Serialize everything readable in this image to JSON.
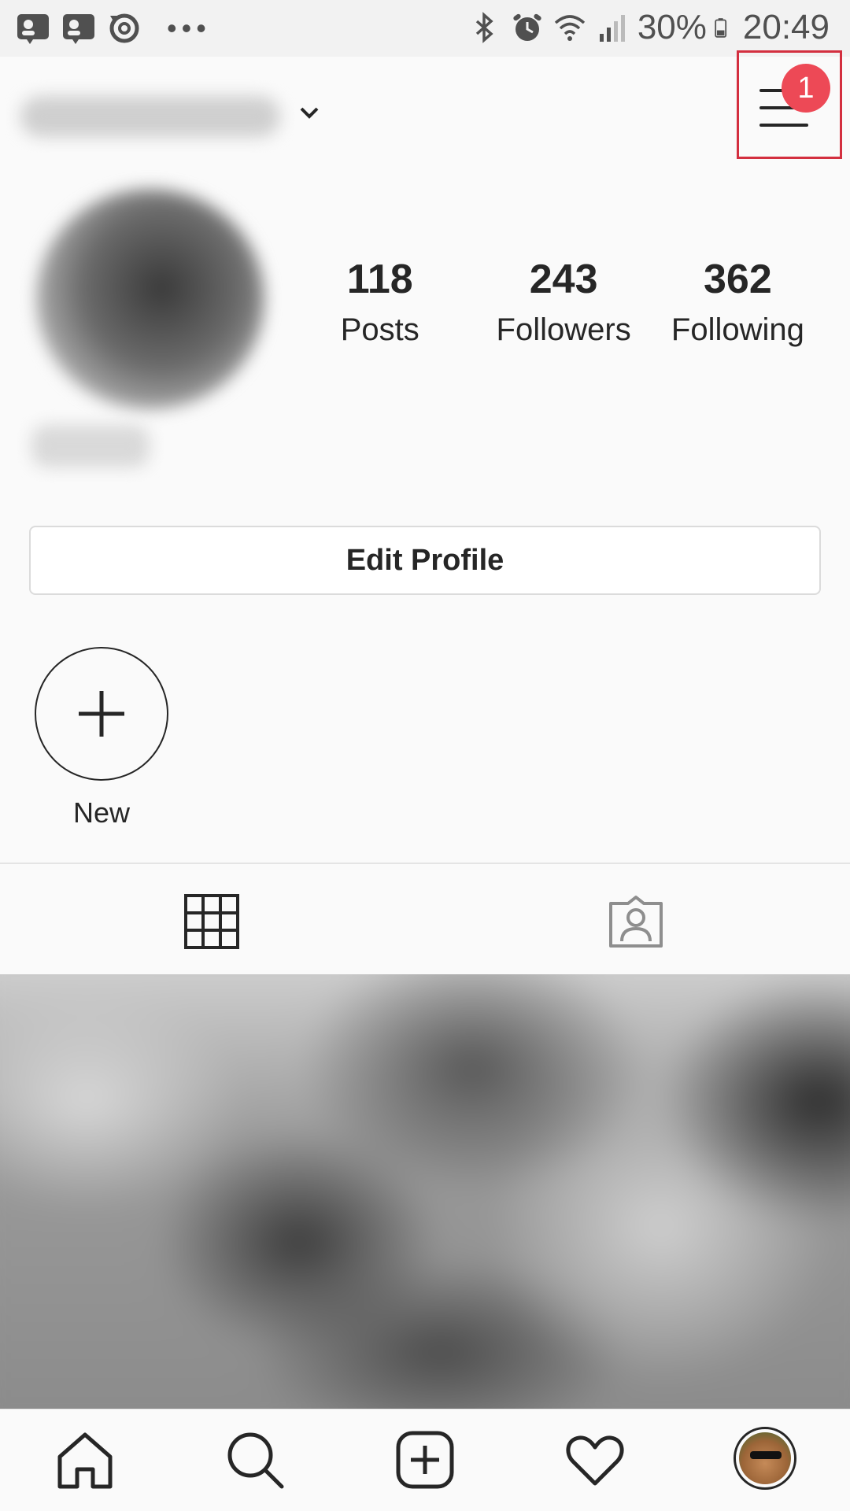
{
  "status_bar": {
    "battery": "30%",
    "time": "20:49",
    "left_icons": [
      "contact-card-icon",
      "contact-card-icon",
      "sync-icon",
      "more-dots-icon"
    ],
    "right_icons": [
      "bluetooth-icon",
      "alarm-icon",
      "wifi-icon",
      "signal-icon",
      "battery-icon"
    ]
  },
  "header": {
    "notification_count": "1"
  },
  "profile": {
    "stats": [
      {
        "value": "118",
        "label": "Posts"
      },
      {
        "value": "243",
        "label": "Followers"
      },
      {
        "value": "362",
        "label": "Following"
      }
    ],
    "edit_button": "Edit Profile"
  },
  "highlights": {
    "new_label": "New"
  },
  "tabs": [
    "grid-icon",
    "tagged-icon"
  ],
  "bottom_nav": [
    "home-icon",
    "search-icon",
    "new-post-icon",
    "activity-heart-icon",
    "profile-avatar"
  ],
  "colors": {
    "badge": "#ed4956",
    "highlight_box": "#d32f3f",
    "text": "#262626",
    "background": "#fafafa"
  }
}
